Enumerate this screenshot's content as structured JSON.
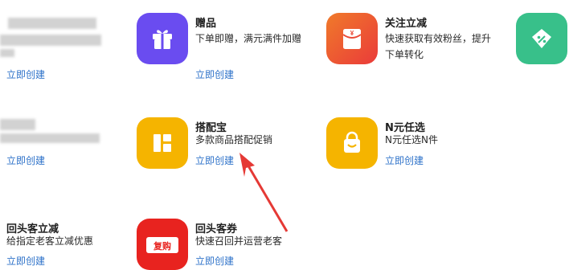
{
  "colors": {
    "link": "#2e72c9",
    "purple": "#6a4cf0",
    "red_orange": "#f04a3a",
    "teal": "#38c08a",
    "yellow": "#f5b400",
    "red": "#e8231f",
    "arrow": "#e53935"
  },
  "cards": {
    "gift": {
      "title": "赠品",
      "desc": "下单即赠，满元满件加赠",
      "link": "立即创建",
      "icon": "gift-icon"
    },
    "follow": {
      "title": "关注立减",
      "desc": "快速获取有效粉丝，提升下单转化",
      "icon": "red-envelope-icon",
      "icon_text": "¥"
    },
    "bundle": {
      "title": "搭配宝",
      "desc": "多款商品搭配促销",
      "link": "立即创建",
      "icon": "layout-grid-icon"
    },
    "nyuan": {
      "title": "N元任选",
      "desc": "N元任选N件",
      "link": "立即创建",
      "icon": "shopping-bag-icon"
    },
    "returning_discount": {
      "title": "回头客立减",
      "desc": "给指定老客立减优惠",
      "link": "立即创建"
    },
    "returning_coupon": {
      "title": "回头客券",
      "desc": "快速召回并运营老客",
      "link": "立即创建",
      "icon": "coupon-icon",
      "icon_text": "复购"
    },
    "left_col": {
      "link1": "立即创建",
      "link2": "立即创建"
    },
    "right_partial": {
      "icon": "price-tag-icon"
    }
  },
  "annotation": {
    "type": "red-arrow",
    "points_to": "搭配宝 立即创建"
  }
}
